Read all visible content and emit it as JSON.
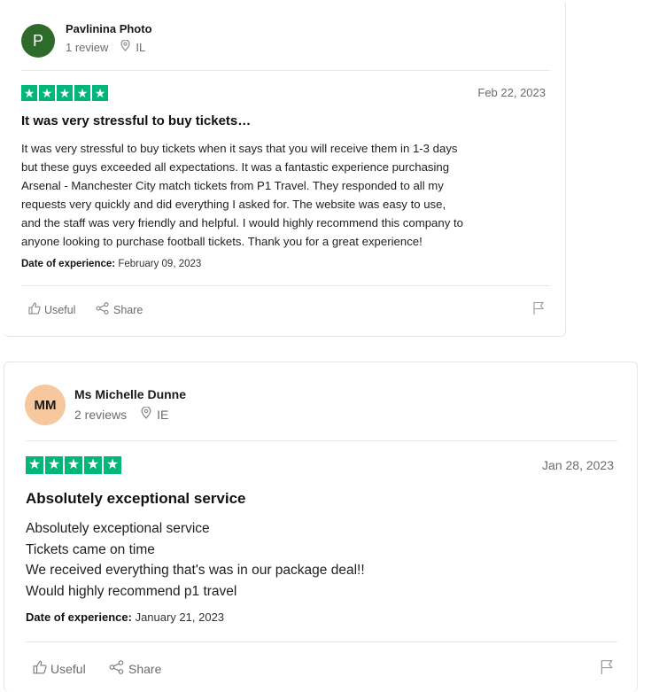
{
  "reviews": [
    {
      "avatar_initials": "P",
      "avatar_bg": "#2e6b2b",
      "avatar_fg": "#ffffff",
      "reviewer_name": "Pavlinina Photo",
      "review_count": "1 review",
      "country": "IL",
      "rating": 5,
      "date": "Feb 22, 2023",
      "title": "It was very stressful to buy tickets…",
      "body_lines": [
        "It was very stressful to buy tickets when it says that you will receive them in 1-3 days",
        "but these guys exceeded all expectations. It was a fantastic experience purchasing",
        "Arsenal - Manchester City match tickets from P1 Travel. They responded to all my",
        "requests very quickly and did everything I asked for. The website was easy to use,",
        "and the staff was very friendly and helpful. I would highly recommend this company to",
        "anyone looking to purchase football tickets. Thank you for a great experience!"
      ],
      "doe_label": "Date of experience:",
      "doe_value": "February 09, 2023",
      "useful_label": "Useful",
      "share_label": "Share"
    },
    {
      "avatar_initials": "MM",
      "avatar_bg": "#f7c79e",
      "avatar_fg": "#1a1a1a",
      "reviewer_name": "Ms Michelle Dunne",
      "review_count": "2 reviews",
      "country": "IE",
      "rating": 5,
      "date": "Jan 28, 2023",
      "title": "Absolutely exceptional service",
      "body_lines": [
        "Absolutely exceptional service",
        "Tickets came on time",
        "We received everything that's was in our package deal!!",
        "Would highly recommend p1 travel"
      ],
      "doe_label": "Date of experience:",
      "doe_value": "January 21, 2023",
      "useful_label": "Useful",
      "share_label": "Share"
    }
  ],
  "colors": {
    "star_green": "#00b67a"
  },
  "icons": {
    "location": "location-pin-icon",
    "useful": "thumbs-up-icon",
    "share": "share-icon",
    "flag": "flag-icon",
    "star": "star-icon"
  }
}
